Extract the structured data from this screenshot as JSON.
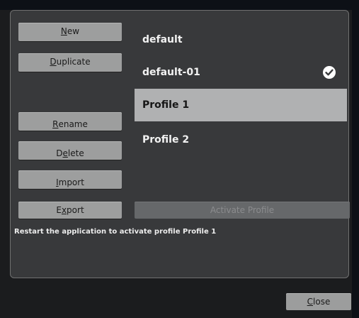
{
  "buttons": {
    "new": {
      "underline": "N",
      "rest": "ew"
    },
    "duplicate": {
      "underline": "D",
      "rest": "uplicate"
    },
    "rename": {
      "underline": "R",
      "rest": "ename"
    },
    "delete": {
      "before": "D",
      "underline": "e",
      "rest": "lete"
    },
    "import": {
      "underline": "I",
      "rest": "mport"
    },
    "export": {
      "before": "E",
      "underline": "x",
      "rest": "port"
    }
  },
  "profiles": [
    {
      "name": "default",
      "active": false,
      "selected": false
    },
    {
      "name": "default-01",
      "active": true,
      "selected": false,
      "active_icon": "check-circle-icon"
    },
    {
      "name": "Profile 1",
      "active": false,
      "selected": true
    },
    {
      "name": "Profile 2",
      "active": false,
      "selected": false
    }
  ],
  "activate_label": "Activate Profile",
  "status_message": "Restart the application to activate profile Profile 1",
  "close": {
    "underline": "C",
    "rest": "lose"
  }
}
